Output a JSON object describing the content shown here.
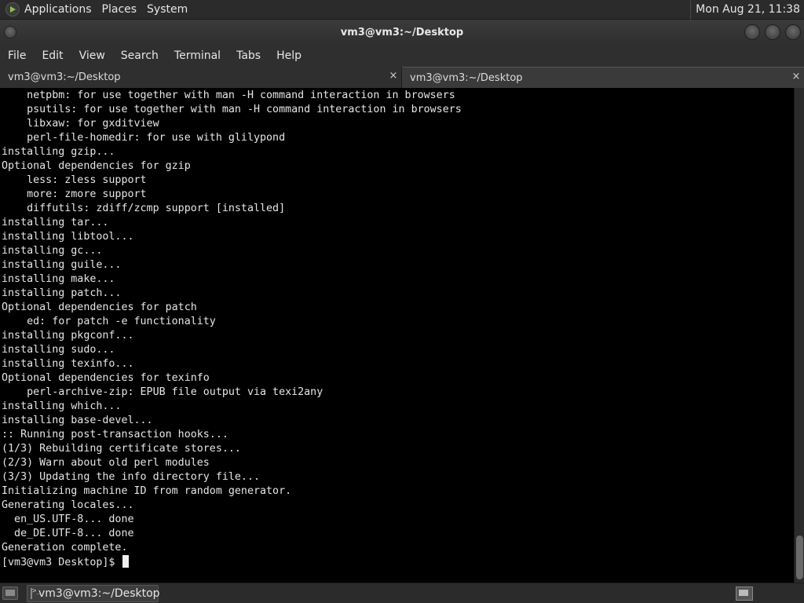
{
  "top_panel": {
    "menus": [
      "Applications",
      "Places",
      "System"
    ],
    "clock": "Mon Aug 21, 11:38"
  },
  "window": {
    "title": "vm3@vm3:~/Desktop"
  },
  "menubar": {
    "items": [
      "File",
      "Edit",
      "View",
      "Search",
      "Terminal",
      "Tabs",
      "Help"
    ]
  },
  "tabs": [
    {
      "label": "vm3@vm3:~/Desktop",
      "close": "×"
    },
    {
      "label": "vm3@vm3:~/Desktop",
      "close": "×"
    }
  ],
  "terminal": {
    "lines": [
      "    netpbm: for use together with man -H command interaction in browsers",
      "    psutils: for use together with man -H command interaction in browsers",
      "    libxaw: for gxditview",
      "    perl-file-homedir: for use with glilypond",
      "installing gzip...",
      "Optional dependencies for gzip",
      "    less: zless support",
      "    more: zmore support",
      "    diffutils: zdiff/zcmp support [installed]",
      "installing tar...",
      "installing libtool...",
      "installing gc...",
      "installing guile...",
      "installing make...",
      "installing patch...",
      "Optional dependencies for patch",
      "    ed: for patch -e functionality",
      "installing pkgconf...",
      "installing sudo...",
      "installing texinfo...",
      "Optional dependencies for texinfo",
      "    perl-archive-zip: EPUB file output via texi2any",
      "installing which...",
      "installing base-devel...",
      ":: Running post-transaction hooks...",
      "(1/3) Rebuilding certificate stores...",
      "(2/3) Warn about old perl modules",
      "(3/3) Updating the info directory file...",
      "Initializing machine ID from random generator.",
      "Generating locales...",
      "  en_US.UTF-8... done",
      "  de_DE.UTF-8... done",
      "Generation complete."
    ],
    "prompt": "[vm3@vm3 Desktop]$ "
  },
  "taskbar": {
    "task_label": "vm3@vm3:~/Desktop"
  }
}
